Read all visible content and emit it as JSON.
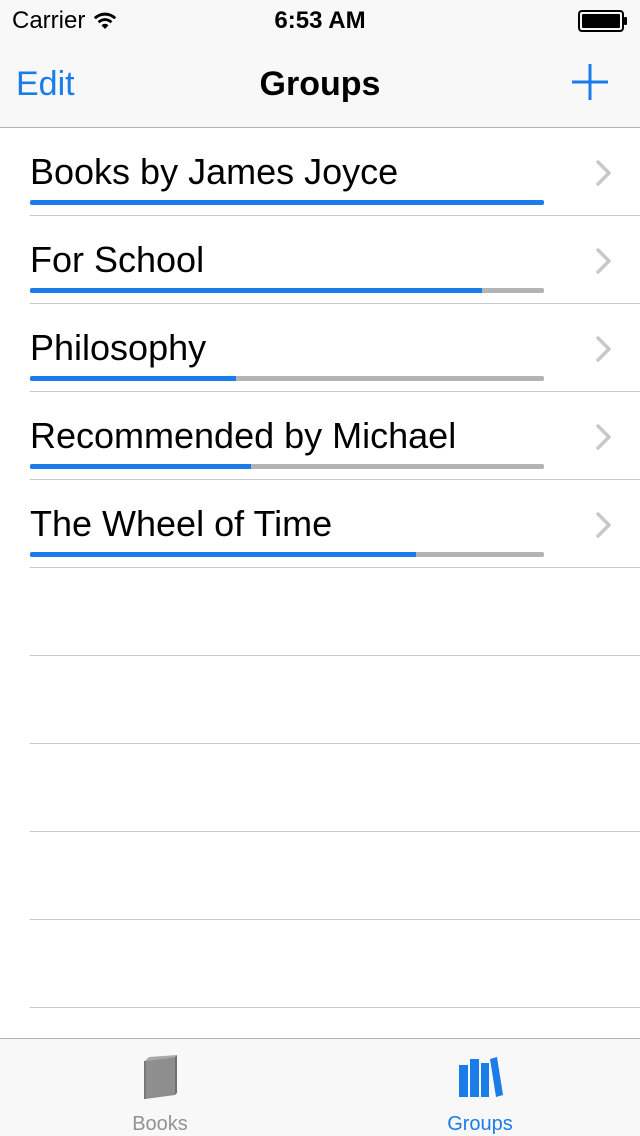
{
  "status_bar": {
    "carrier": "Carrier",
    "time": "6:53 AM",
    "wifi_icon": "wifi-icon",
    "battery_icon": "battery-icon"
  },
  "nav": {
    "edit_label": "Edit",
    "title": "Groups",
    "add_icon": "plus-icon"
  },
  "colors": {
    "accent": "#1a7ce8",
    "progress_track": "#b4b4b4",
    "separator": "#c8c7cc",
    "bar_background": "#f8f8f8",
    "inactive_tab": "#929292"
  },
  "groups": [
    {
      "name": "Books by James Joyce",
      "progress": 1.0
    },
    {
      "name": "For School",
      "progress": 0.88
    },
    {
      "name": "Philosophy",
      "progress": 0.4
    },
    {
      "name": "Recommended by Michael",
      "progress": 0.43
    },
    {
      "name": "The Wheel of Time",
      "progress": 0.75
    }
  ],
  "tab_bar": {
    "tabs": [
      {
        "label": "Books",
        "icon": "book-icon",
        "active": false
      },
      {
        "label": "Groups",
        "icon": "books-shelf-icon",
        "active": true
      }
    ]
  }
}
